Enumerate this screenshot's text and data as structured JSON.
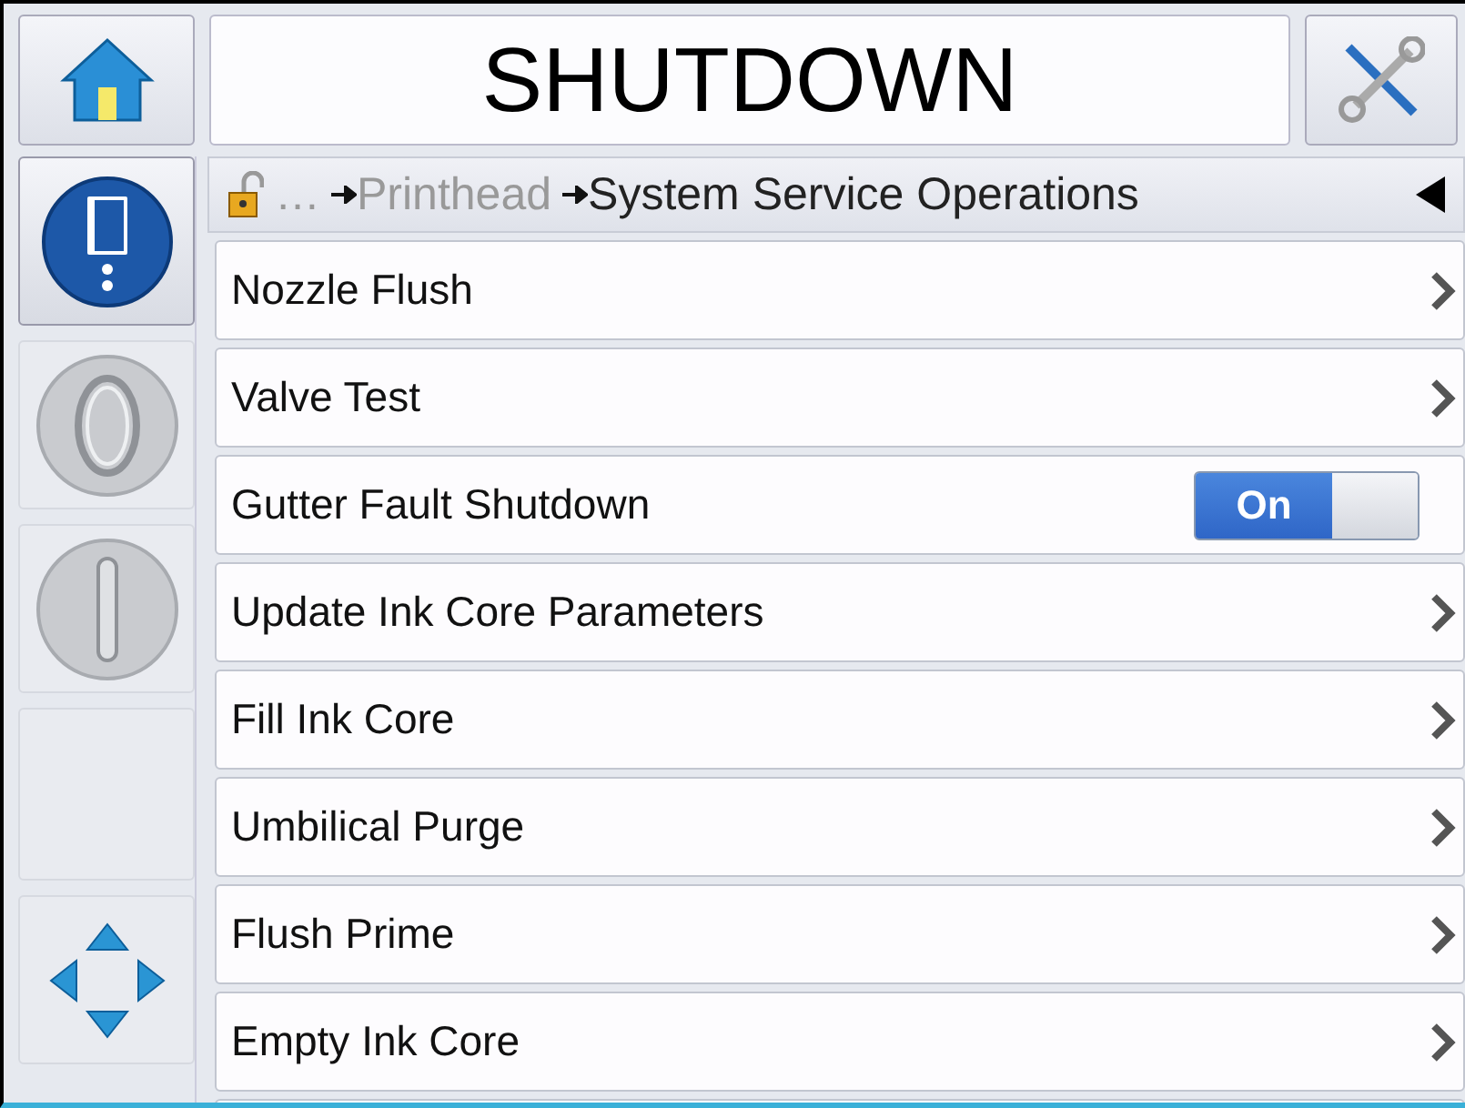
{
  "header": {
    "title": "SHUTDOWN"
  },
  "sidebar": [
    {
      "kind": "ink",
      "selected": true
    },
    {
      "kind": "stop",
      "selected": false
    },
    {
      "kind": "start",
      "selected": false
    },
    {
      "kind": "empty",
      "selected": false
    },
    {
      "kind": "nav",
      "selected": false
    }
  ],
  "breadcrumb": {
    "ellipsis": "…",
    "items": [
      {
        "label": "Printhead",
        "current": false
      },
      {
        "label": "System Service Operations",
        "current": true
      }
    ]
  },
  "rows": [
    {
      "kind": "link",
      "label": "Nozzle Flush"
    },
    {
      "kind": "link",
      "label": "Valve Test"
    },
    {
      "kind": "toggle",
      "label": "Gutter Fault Shutdown",
      "on": true,
      "state_label": "On"
    },
    {
      "kind": "link",
      "label": "Update Ink Core Parameters"
    },
    {
      "kind": "link",
      "label": "Fill Ink Core"
    },
    {
      "kind": "link",
      "label": "Umbilical Purge"
    },
    {
      "kind": "link",
      "label": "Flush Prime"
    },
    {
      "kind": "link",
      "label": "Empty Ink Core"
    }
  ]
}
